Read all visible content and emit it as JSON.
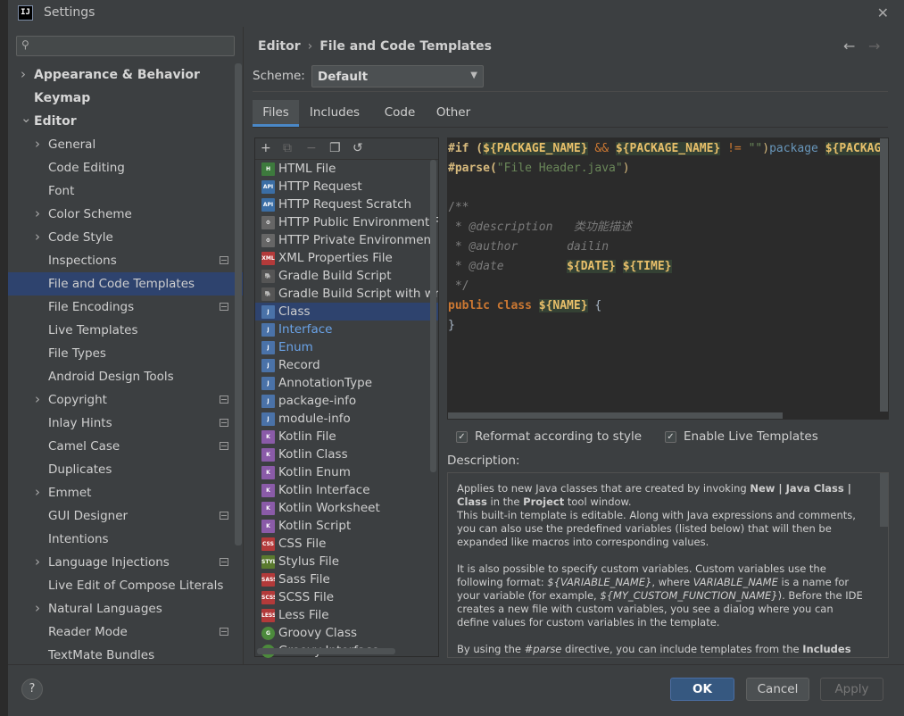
{
  "window": {
    "title": "Settings",
    "logo": "IJ"
  },
  "search": {
    "placeholder": ""
  },
  "tree": [
    {
      "label": "Appearance & Behavior",
      "bold": true,
      "chev": true,
      "indent": 0
    },
    {
      "label": "Keymap",
      "bold": true,
      "chev": false,
      "indent": 0
    },
    {
      "label": "Editor",
      "bold": true,
      "chev": "down",
      "indent": 0
    },
    {
      "label": "General",
      "chev": true,
      "indent": 1
    },
    {
      "label": "Code Editing",
      "indent": 2
    },
    {
      "label": "Font",
      "indent": 2
    },
    {
      "label": "Color Scheme",
      "chev": true,
      "indent": 1
    },
    {
      "label": "Code Style",
      "chev": true,
      "indent": 1
    },
    {
      "label": "Inspections",
      "indent": 2,
      "opt": true
    },
    {
      "label": "File and Code Templates",
      "indent": 2,
      "selected": true
    },
    {
      "label": "File Encodings",
      "indent": 2,
      "opt": true
    },
    {
      "label": "Live Templates",
      "indent": 2
    },
    {
      "label": "File Types",
      "indent": 2
    },
    {
      "label": "Android Design Tools",
      "indent": 2
    },
    {
      "label": "Copyright",
      "chev": true,
      "indent": 1,
      "opt": true
    },
    {
      "label": "Inlay Hints",
      "indent": 2,
      "opt": true
    },
    {
      "label": "Camel Case",
      "indent": 2,
      "opt": true
    },
    {
      "label": "Duplicates",
      "indent": 2
    },
    {
      "label": "Emmet",
      "chev": true,
      "indent": 1
    },
    {
      "label": "GUI Designer",
      "indent": 2,
      "opt": true
    },
    {
      "label": "Intentions",
      "indent": 2
    },
    {
      "label": "Language Injections",
      "chev": true,
      "indent": 1,
      "opt": true
    },
    {
      "label": "Live Edit of Compose Literals",
      "indent": 2
    },
    {
      "label": "Natural Languages",
      "chev": true,
      "indent": 1
    },
    {
      "label": "Reader Mode",
      "indent": 2,
      "opt": true
    },
    {
      "label": "TextMate Bundles",
      "indent": 2
    }
  ],
  "breadcrumb": {
    "root": "Editor",
    "sep": "›",
    "current": "File and Code Templates",
    "back": "←",
    "forward": "→"
  },
  "scheme": {
    "label": "Scheme:",
    "value": "Default"
  },
  "tabs": [
    "Files",
    "Includes",
    "Code",
    "Other"
  ],
  "toolbar": {
    "add": "+",
    "copy": "⧉",
    "remove": "−",
    "duplicate": "❐",
    "reset": "↺"
  },
  "files": [
    {
      "label": "HTML File",
      "icon": "html-icon",
      "color": "#3d7a3d",
      "tag": "H"
    },
    {
      "label": "HTTP Request",
      "icon": "api-icon",
      "color": "#3b6ea5",
      "tag": "API"
    },
    {
      "label": "HTTP Request Scratch",
      "icon": "api-icon",
      "color": "#3b6ea5",
      "tag": "API"
    },
    {
      "label": "HTTP Public Environment File",
      "icon": "env-icon",
      "color": "#666666",
      "tag": "⚙"
    },
    {
      "label": "HTTP Private Environment File",
      "icon": "env-icon",
      "color": "#666666",
      "tag": "⚙"
    },
    {
      "label": "XML Properties File",
      "icon": "xml-icon",
      "color": "#b33a3a",
      "tag": "XML"
    },
    {
      "label": "Gradle Build Script",
      "icon": "gradle-icon",
      "color": "#555555",
      "tag": "🐘"
    },
    {
      "label": "Gradle Build Script with wrapper",
      "icon": "gradle-icon",
      "color": "#555555",
      "tag": "🐘"
    },
    {
      "label": "Class",
      "icon": "java-icon",
      "color": "#4a72a8",
      "tag": "J",
      "selected": true
    },
    {
      "label": "Interface",
      "icon": "java-icon",
      "color": "#4a72a8",
      "tag": "J",
      "blue": true
    },
    {
      "label": "Enum",
      "icon": "java-icon",
      "color": "#4a72a8",
      "tag": "J",
      "blue": true
    },
    {
      "label": "Record",
      "icon": "java-icon",
      "color": "#4a72a8",
      "tag": "J"
    },
    {
      "label": "AnnotationType",
      "icon": "java-icon",
      "color": "#4a72a8",
      "tag": "J"
    },
    {
      "label": "package-info",
      "icon": "java-icon",
      "color": "#4a72a8",
      "tag": "J"
    },
    {
      "label": "module-info",
      "icon": "java-icon",
      "color": "#4a72a8",
      "tag": "J"
    },
    {
      "label": "Kotlin File",
      "icon": "kotlin-icon",
      "color": "#8a5ba8",
      "tag": "K"
    },
    {
      "label": "Kotlin Class",
      "icon": "kotlin-icon",
      "color": "#8a5ba8",
      "tag": "K"
    },
    {
      "label": "Kotlin Enum",
      "icon": "kotlin-icon",
      "color": "#8a5ba8",
      "tag": "K"
    },
    {
      "label": "Kotlin Interface",
      "icon": "kotlin-icon",
      "color": "#8a5ba8",
      "tag": "K"
    },
    {
      "label": "Kotlin Worksheet",
      "icon": "kotlin-icon",
      "color": "#8a5ba8",
      "tag": "K"
    },
    {
      "label": "Kotlin Script",
      "icon": "kotlin-icon",
      "color": "#8a5ba8",
      "tag": "K"
    },
    {
      "label": "CSS File",
      "icon": "css-icon",
      "color": "#b33a3a",
      "tag": "CSS"
    },
    {
      "label": "Stylus File",
      "icon": "stylus-icon",
      "color": "#5a7a2e",
      "tag": "STYL"
    },
    {
      "label": "Sass File",
      "icon": "sass-icon",
      "color": "#b33a3a",
      "tag": "SASS"
    },
    {
      "label": "SCSS File",
      "icon": "scss-icon",
      "color": "#b33a3a",
      "tag": "SCSS"
    },
    {
      "label": "Less File",
      "icon": "less-icon",
      "color": "#b33a3a",
      "tag": "LESS"
    },
    {
      "label": "Groovy Class",
      "icon": "groovy-icon",
      "color": "#4c8a3c",
      "tag": "G",
      "round": true
    },
    {
      "label": "Groovy Interface",
      "icon": "groovy-icon",
      "color": "#4c8a3c",
      "tag": "G",
      "round": true
    }
  ],
  "code": [
    [
      [
        "#if (",
        "#d7ba7d"
      ],
      [
        "${PACKAGE_NAME}",
        "#e8bf6a"
      ],
      [
        " && ",
        "#cc7832"
      ],
      [
        "${PACKAGE_NAME}",
        "#e8bf6a"
      ],
      [
        " != ",
        "#cc7832"
      ],
      [
        "\"\"",
        "#6a8759"
      ],
      [
        ")",
        "#d7ba7d"
      ],
      [
        "package ",
        "#6896ba"
      ],
      [
        "${PACKAGE_NAME};#end",
        "#e8bf6a"
      ]
    ],
    [
      [
        "#parse(",
        "#d7ba7d"
      ],
      [
        "\"File Header.java\"",
        "#6a8759"
      ],
      [
        ")",
        "#d7ba7d"
      ]
    ],
    [],
    [
      [
        "/**",
        "#808080"
      ]
    ],
    [
      [
        " * ",
        "#808080"
      ],
      [
        "@description",
        "#7a7a7a"
      ],
      [
        "   类功能描述",
        "#7a7a7a"
      ]
    ],
    [
      [
        " * ",
        "#808080"
      ],
      [
        "@author",
        "#7a7a7a"
      ],
      [
        "       dailin",
        "#7a7a7a"
      ]
    ],
    [
      [
        " * ",
        "#808080"
      ],
      [
        "@date",
        "#7a7a7a"
      ],
      [
        "         ",
        "#808080"
      ],
      [
        "${DATE}",
        "#e8bf6a"
      ],
      [
        " ",
        "#808080"
      ],
      [
        "${TIME}",
        "#e8bf6a"
      ]
    ],
    [
      [
        " */",
        "#808080"
      ]
    ],
    [
      [
        "public class ",
        "#cc7832"
      ],
      [
        "${NAME}",
        "#e8bf6a"
      ],
      [
        " {",
        "#a9b7c6"
      ]
    ],
    [
      [
        "}",
        "#a9b7c6"
      ]
    ]
  ],
  "options": {
    "reformat": "Reformat according to style",
    "live": "Enable Live Templates"
  },
  "description": {
    "label": "Description:",
    "p1a": "Applies to new Java classes that are created by invoking ",
    "p1b": "New | Java Class | Class",
    "p1c": " in the ",
    "p1d": "Project",
    "p1e": " tool window.",
    "p1f": "This built-in template is editable. Along with Java expressions and comments, you can also use the predefined variables (listed below) that will then be expanded like macros into corresponding values.",
    "p2a": "It is also possible to specify custom variables. Custom variables use the following format: ",
    "p2b": "${VARIABLE_NAME}",
    "p2c": ", where ",
    "p2d": "VARIABLE_NAME",
    "p2e": " is a name for your variable (for example, ",
    "p2f": "${MY_CUSTOM_FUNCTION_NAME}",
    "p2g": "). Before the IDE creates a new file with custom variables, you see a dialog where you can define values for custom variables in the template.",
    "p3a": "By using the ",
    "p3b": "#parse",
    "p3c": " directive, you can include templates from the ",
    "p3d": "Includes"
  },
  "footer": {
    "help": "?",
    "ok": "OK",
    "cancel": "Cancel",
    "apply": "Apply"
  }
}
